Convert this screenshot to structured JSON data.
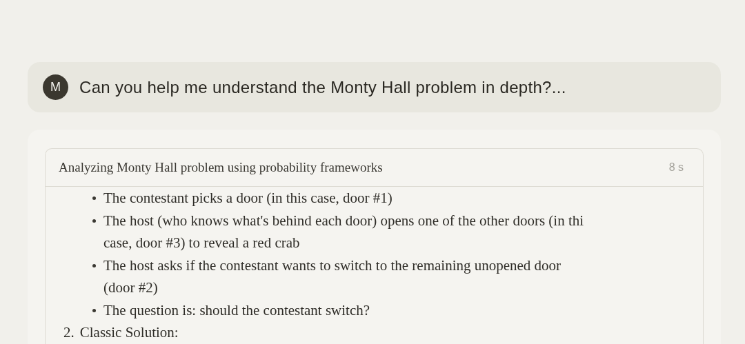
{
  "user_message": {
    "avatar": "M",
    "text": "Can you help me understand the Monty Hall problem in depth?..."
  },
  "thinking": {
    "title": "Analyzing Monty Hall problem using probability frameworks",
    "duration": "8 s",
    "bullets": [
      {
        "lines": [
          "The contestant picks a door (in this case, door #1)"
        ]
      },
      {
        "lines": [
          "The host (who knows what's behind each door) opens one of the other doors (in thi",
          "case, door #3) to reveal a red crab"
        ]
      },
      {
        "lines": [
          "The host asks if the contestant wants to switch to the remaining unopened door",
          "(door #2)"
        ]
      },
      {
        "lines": [
          "The question is: should the contestant switch?"
        ]
      }
    ],
    "numbered": [
      {
        "number": "2.",
        "text": "Classic Solution:"
      }
    ]
  }
}
